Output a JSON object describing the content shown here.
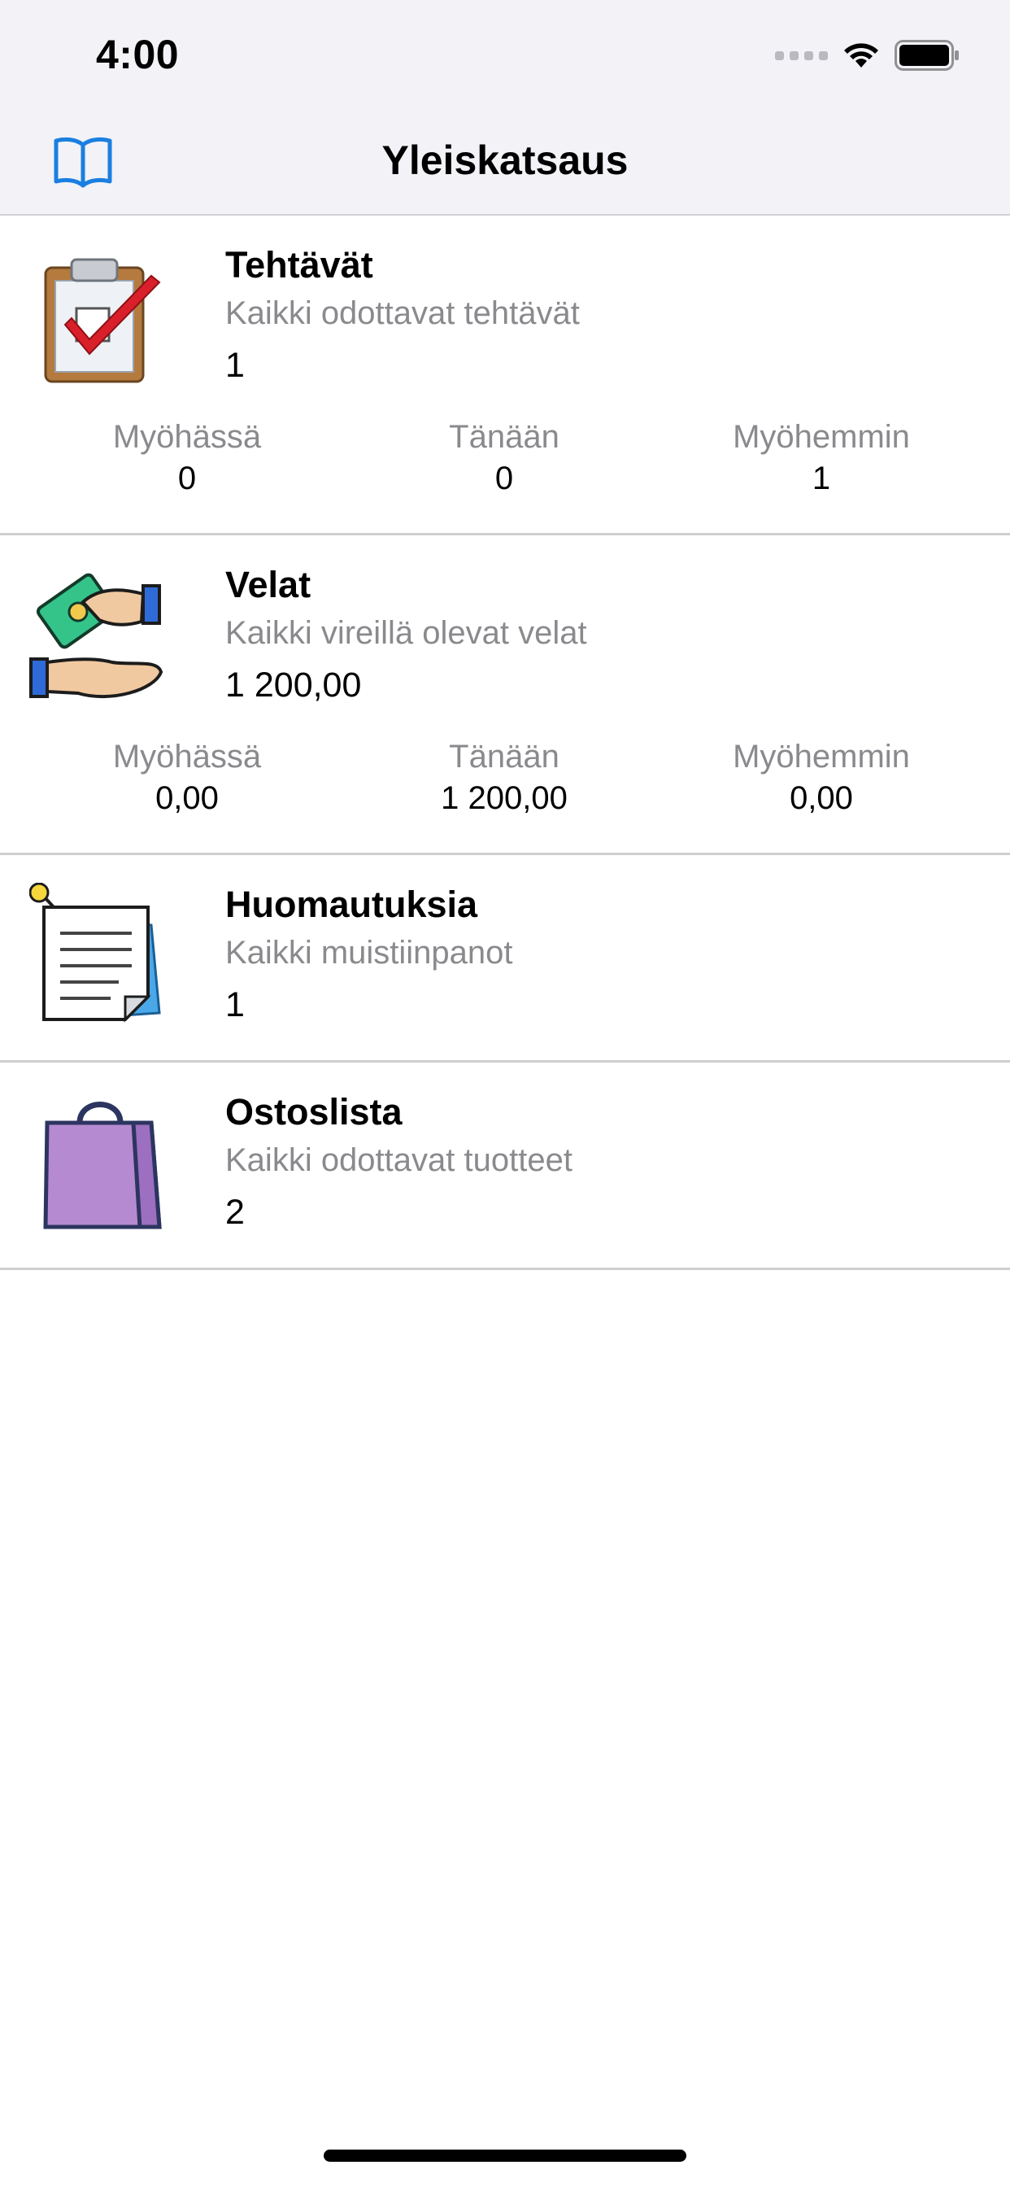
{
  "status": {
    "time": "4:00"
  },
  "nav": {
    "title": "Yleiskatsaus",
    "left_icon": "book-icon"
  },
  "cards": [
    {
      "title": "Tehtävät",
      "subtitle": "Kaikki odottavat tehtävät",
      "value": "1",
      "icon": "clipboard-check-icon",
      "stats": [
        {
          "label": "Myöhässä",
          "value": "0"
        },
        {
          "label": "Tänään",
          "value": "0"
        },
        {
          "label": "Myöhemmin",
          "value": "1"
        }
      ]
    },
    {
      "title": "Velat",
      "subtitle": "Kaikki vireillä olevat velat",
      "value": "1 200,00",
      "icon": "money-exchange-icon",
      "stats": [
        {
          "label": "Myöhässä",
          "value": "0,00"
        },
        {
          "label": "Tänään",
          "value": "1 200,00"
        },
        {
          "label": "Myöhemmin",
          "value": "0,00"
        }
      ]
    },
    {
      "title": "Huomautuksia",
      "subtitle": "Kaikki muistiinpanot",
      "value": "1",
      "icon": "pinned-note-icon"
    },
    {
      "title": "Ostoslista",
      "subtitle": "Kaikki odottavat tuotteet",
      "value": "2",
      "icon": "shopping-bag-icon"
    }
  ],
  "colors": {
    "accent": "#1a7fe0",
    "secondary_text": "#8a8a8e",
    "nav_bg": "#f2f2f7"
  }
}
